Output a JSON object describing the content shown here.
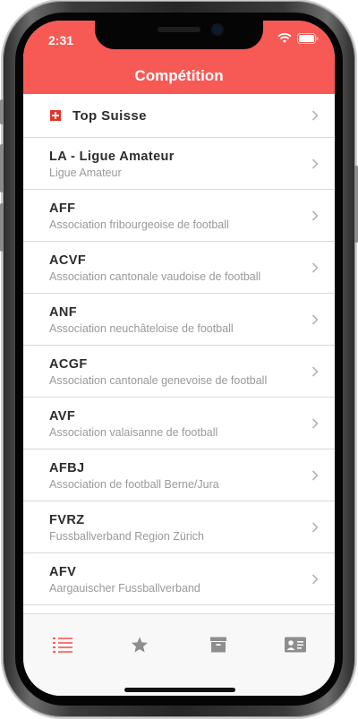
{
  "status_bar": {
    "time": "2:31"
  },
  "header": {
    "title": "Compétition"
  },
  "list": {
    "top_item": {
      "label": "Top Suisse",
      "flag_icon": "swiss-flag-icon"
    },
    "items": [
      {
        "title": "LA - Ligue Amateur",
        "subtitle": "Ligue Amateur"
      },
      {
        "title": "AFF",
        "subtitle": "Association fribourgeoise de football"
      },
      {
        "title": "ACVF",
        "subtitle": "Association cantonale vaudoise de football"
      },
      {
        "title": "ANF",
        "subtitle": "Association neuchâteloise de football"
      },
      {
        "title": "ACGF",
        "subtitle": "Association cantonale genevoise de football"
      },
      {
        "title": "AVF",
        "subtitle": "Association valaisanne de football"
      },
      {
        "title": "AFBJ",
        "subtitle": "Association de football Berne/Jura"
      },
      {
        "title": "FVRZ",
        "subtitle": "Fussballverband Region Zürich"
      },
      {
        "title": "AFV",
        "subtitle": "Aargauischer Fussballverband"
      }
    ]
  },
  "tabbar": {
    "tabs": [
      {
        "icon": "list-icon",
        "active": true
      },
      {
        "icon": "star-icon",
        "active": false
      },
      {
        "icon": "archive-icon",
        "active": false
      },
      {
        "icon": "contact-card-icon",
        "active": false
      }
    ]
  },
  "colors": {
    "accent": "#f75a55",
    "title_text": "#2c2c2c",
    "subtitle_text": "#9a9a9a",
    "inactive_icon": "#8e8e8e",
    "separator": "#d9d9d9"
  }
}
